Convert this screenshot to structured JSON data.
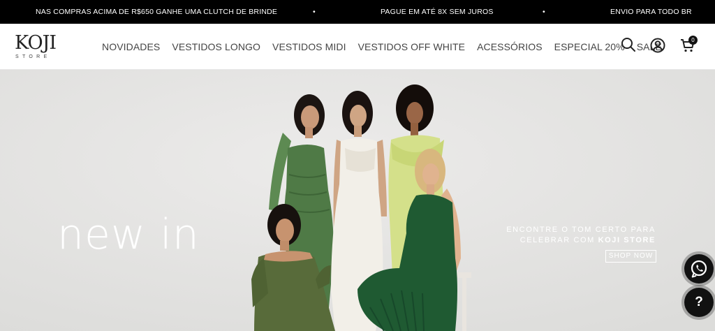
{
  "announcement": {
    "message_1": "NAS COMPRAS ACIMA DE R$650 GANHE UMA CLUTCH DE BRINDE",
    "separator": "•",
    "message_2": "PAGUE EM ATÉ 8X SEM JUROS",
    "message_3": "ENVIO PARA TODO BR"
  },
  "logo": {
    "word": "KOJI",
    "subtitle": "STORE"
  },
  "nav": {
    "items": [
      "NOVIDADES",
      "VESTIDOS LONGO",
      "VESTIDOS MIDI",
      "VESTIDOS OFF WHITE",
      "ACESSÓRIOS",
      "ESPECIAL 20%",
      "SALE"
    ]
  },
  "cart": {
    "count": "0"
  },
  "hero": {
    "headline": "new in",
    "tagline_line1": "ENCONTRE O TOM CERTO PARA",
    "tagline_line2_prefix": "CELEBRAR COM ",
    "tagline_brand": "KOJI STORE",
    "cta": "SHOP NOW"
  },
  "floating": {
    "help_label": "?"
  },
  "colors": {
    "topbar_bg": "#000000",
    "hero_bg": "#e7e7e5",
    "dress_green": "#4f7a46",
    "dress_dark_green": "#1f5a32",
    "dress_lime": "#d4e08a",
    "dress_white": "#f2efe8",
    "dress_olive": "#586b3a"
  },
  "icons": [
    "search-icon",
    "account-icon",
    "cart-icon",
    "whatsapp-icon",
    "help-icon"
  ]
}
